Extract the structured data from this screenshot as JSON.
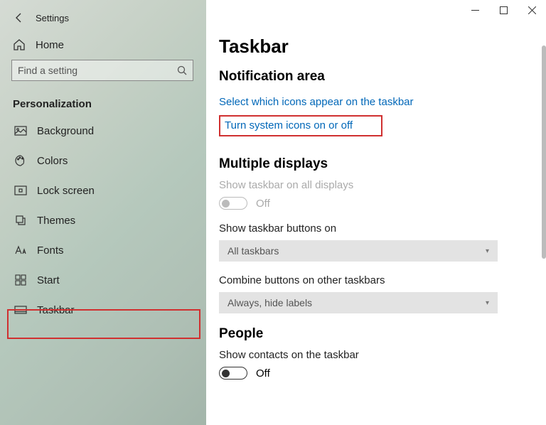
{
  "titlebar": {
    "app_name": "Settings"
  },
  "sidebar": {
    "home_label": "Home",
    "search_placeholder": "Find a setting",
    "section_title": "Personalization",
    "items": [
      {
        "label": "Background"
      },
      {
        "label": "Colors"
      },
      {
        "label": "Lock screen"
      },
      {
        "label": "Themes"
      },
      {
        "label": "Fonts"
      },
      {
        "label": "Start"
      },
      {
        "label": "Taskbar"
      }
    ]
  },
  "main": {
    "title": "Taskbar",
    "sections": {
      "notification": {
        "heading": "Notification area",
        "link1": "Select which icons appear on the taskbar",
        "link2": "Turn system icons on or off"
      },
      "multiple_displays": {
        "heading": "Multiple displays",
        "show_all_label": "Show taskbar on all displays",
        "show_all_state": "Off",
        "buttons_on_label": "Show taskbar buttons on",
        "buttons_on_value": "All taskbars",
        "combine_label": "Combine buttons on other taskbars",
        "combine_value": "Always, hide labels"
      },
      "people": {
        "heading": "People",
        "contacts_label": "Show contacts on the taskbar",
        "contacts_state": "Off"
      }
    }
  }
}
